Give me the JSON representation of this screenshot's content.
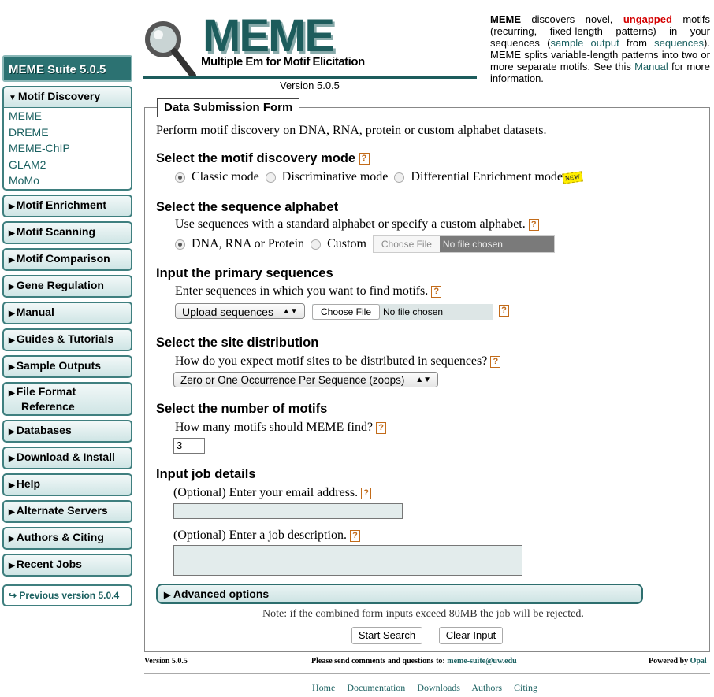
{
  "header": {
    "logo_title": "MEME",
    "logo_subtitle": "Multiple Em for Motif Elicitation",
    "version": "Version 5.0.5"
  },
  "intro": {
    "p1_bold": "MEME",
    "p1a": " discovers novel, ",
    "ungapped": "ungapped",
    "p1b": " motifs (recurring, fixed-length patterns) in your sequences (",
    "link_sample": "sample output",
    "p1c": " from ",
    "link_sequences": "sequences",
    "p1d": "). MEME splits variable-length patterns into two or more separate motifs. See this ",
    "link_manual": "Manual",
    "p1e": " for more information."
  },
  "sidebar": {
    "suite_title": "MEME Suite 5.0.5",
    "open_section": "Motif Discovery",
    "open_items": [
      "MEME",
      "DREME",
      "MEME-ChIP",
      "GLAM2",
      "MoMo"
    ],
    "sections": [
      "Motif Enrichment",
      "Motif Scanning",
      "Motif Comparison",
      "Gene Regulation",
      "Manual",
      "Guides & Tutorials",
      "Sample Outputs"
    ],
    "file_format": [
      "File Format",
      "Reference"
    ],
    "sections2": [
      "Databases",
      "Download & Install",
      "Help",
      "Alternate Servers",
      "Authors & Citing",
      "Recent Jobs"
    ],
    "prev_version": "Previous version 5.0.4"
  },
  "form": {
    "legend": "Data Submission Form",
    "intro": "Perform motif discovery on DNA, RNA, protein or custom alphabet datasets.",
    "mode_title": "Select the motif discovery mode",
    "mode_classic": "Classic mode",
    "mode_discriminative": "Discriminative mode",
    "mode_differential": "Differential Enrichment mode",
    "new_badge": "NEW",
    "alphabet_title": "Select the sequence alphabet",
    "alphabet_desc": "Use sequences with a standard alphabet or specify a custom alphabet.",
    "alphabet_std": "DNA, RNA or Protein",
    "alphabet_custom": "Custom",
    "choose_file": "Choose File",
    "no_file": "No file chosen",
    "primary_title": "Input the primary sequences",
    "primary_desc": "Enter sequences in which you want to find motifs.",
    "upload_select": "Upload sequences",
    "dist_title": "Select the site distribution",
    "dist_desc": "How do you expect motif sites to be distributed in sequences?",
    "dist_select": "Zero or One Occurrence Per Sequence (zoops)",
    "nmotifs_title": "Select the number of motifs",
    "nmotifs_desc": "How many motifs should MEME find?",
    "nmotifs_value": "3",
    "job_title": "Input job details",
    "email_desc": "(Optional) Enter your email address.",
    "email_value": "",
    "jobdesc_desc": "(Optional) Enter a job description.",
    "jobdesc_value": "",
    "advanced": "Advanced options",
    "note": "Note: if the combined form inputs exceed 80MB the job will be rejected.",
    "start": "Start Search",
    "clear": "Clear Input",
    "help_glyph": "?"
  },
  "footer": {
    "version": "Version 5.0.5",
    "contact_pre": "Please send comments and questions to: ",
    "contact_email": "meme-suite@uw.edu",
    "powered_pre": "Powered by ",
    "powered_link": "Opal",
    "nav": [
      "Home",
      "Documentation",
      "Downloads",
      "Authors",
      "Citing"
    ]
  },
  "colors": {
    "teal_dark": "#1d5c5c",
    "link": "#1a6060",
    "help_orange": "#c26b1a",
    "ungapped_red": "#d40000"
  }
}
